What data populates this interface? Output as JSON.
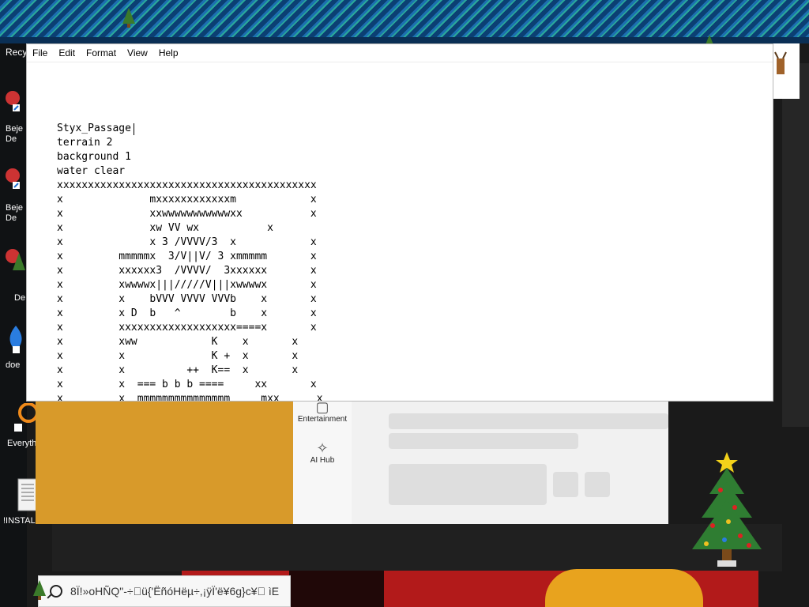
{
  "desktop": {
    "icons": [
      {
        "label": "Recy"
      },
      {
        "label": "Beje\nDe"
      },
      {
        "label": "Beje\nDe"
      },
      {
        "label": "De"
      },
      {
        "label": "doe"
      },
      {
        "label": "Everyth"
      },
      {
        "label": "!INSTAL"
      }
    ]
  },
  "notepad": {
    "menu": [
      "File",
      "Edit",
      "Format",
      "View",
      "Help"
    ],
    "content": "Styx_Passage\nterrain 2\nbackground 1\nwater clear\nxxxxxxxxxxxxxxxxxxxxxxxxxxxxxxxxxxxxxxxxxx\nx              mxxxxxxxxxxxxm            x\nx              xxwwwwwwwwwwwxx           x\nx              xw VV wx           x\nx              x 3 /VVVV/3  x            x\nx         mmmmmx  3/V||V/ 3 xmmmmm       x\nx         xxxxxx3  /VVVV/  3xxxxxx       x\nx         xwwwwx|||/////V|||xwwwwx       x\nx         x    bVVV VVVV VVVb    x       x\nx         x D  b   ^        b    x       x\nx         xxxxxxxxxxxxxxxxxxx====x       x\nx         xww            K    x       x\nx         x              K +  x       x\nx         x          ++  K==  x       x\nx         x  === b b b ====     xx       x\nx         x  mmmmmmmmmmmmmmm     mxx      x"
  },
  "background_app": {
    "nav": [
      {
        "icon": "entertainment-icon",
        "label": "Entertainment"
      },
      {
        "icon": "ai-hub-icon",
        "label": "AI Hub"
      }
    ]
  },
  "taskbar": {
    "search_text": "8Ï!»oHÑQ\"-÷\u0000ü{'ËñóHëµ÷,¡ÿÏ'ë¥6g}c¥\u0000 ìE"
  },
  "colors": {
    "banner": "#0b3f73",
    "app_yellow": "#d89a2a",
    "tree_green": "#2f7d32"
  }
}
